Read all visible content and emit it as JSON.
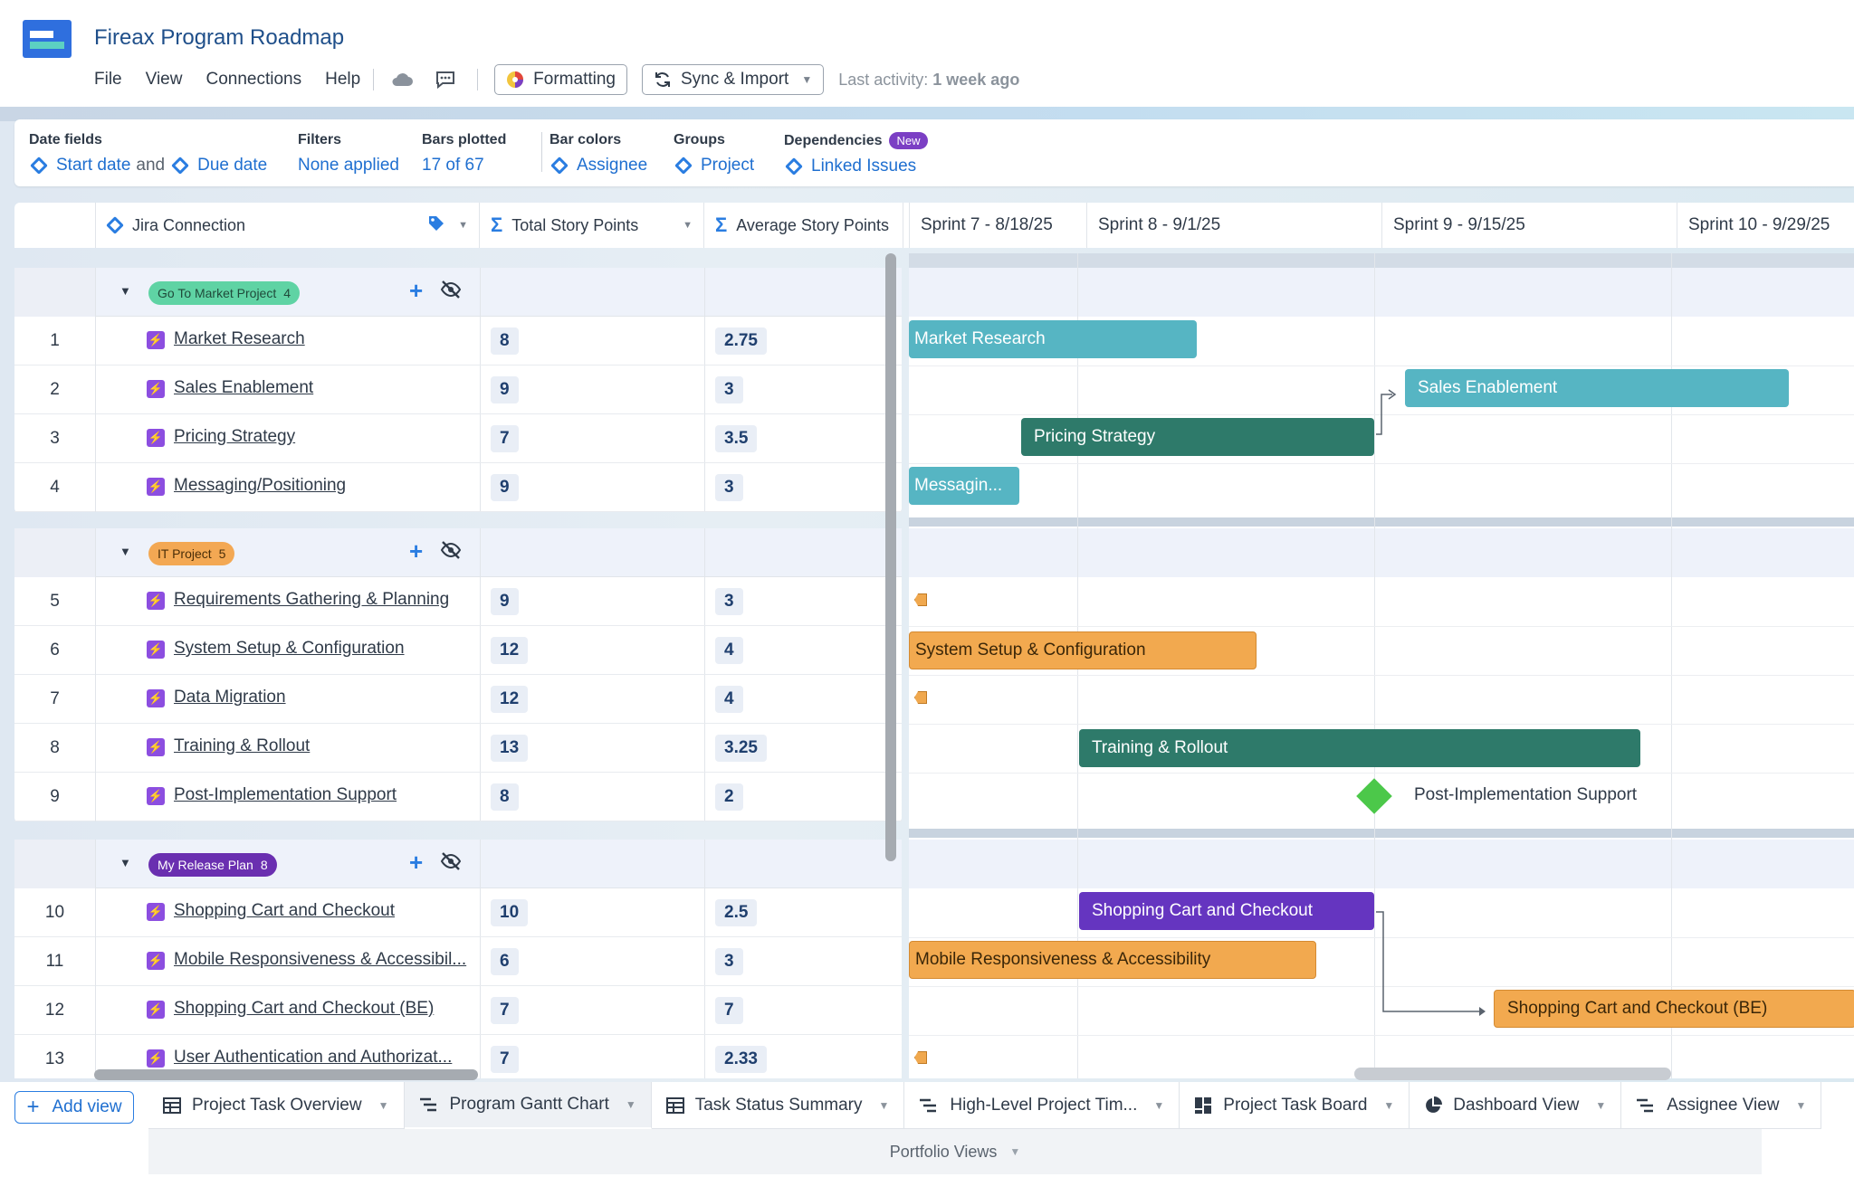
{
  "app": {
    "title": "Fireax Program Roadmap"
  },
  "menu": {
    "file": "File",
    "view": "View",
    "connections": "Connections",
    "help": "Help",
    "formatting": "Formatting",
    "sync": "Sync & Import",
    "last_activity_label": "Last activity:",
    "last_activity_value": "1 week ago"
  },
  "settings": {
    "date_fields": {
      "label": "Date fields",
      "start": "Start date",
      "and": "and",
      "due": "Due date"
    },
    "filters": {
      "label": "Filters",
      "value": "None applied"
    },
    "bars": {
      "label": "Bars plotted",
      "value": "17 of 67"
    },
    "colors": {
      "label": "Bar colors",
      "value": "Assignee"
    },
    "groups": {
      "label": "Groups",
      "value": "Project"
    },
    "deps": {
      "label": "Dependencies",
      "badge": "New",
      "value": "Linked Issues"
    }
  },
  "columns": {
    "name": "Jira Connection",
    "total": "Total Story Points",
    "avg": "Average Story Points"
  },
  "sprints": [
    "Sprint 7 - 8/18/25",
    "Sprint 8 - 9/1/25",
    "Sprint 9 - 9/15/25",
    "Sprint 10 - 9/29/25"
  ],
  "groups": [
    {
      "name": "Go To Market Project",
      "count": "4",
      "color": "#5fd3a4",
      "text": "#1f4a3a"
    },
    {
      "name": "IT Project",
      "count": "5",
      "color": "#f3a853",
      "text": "#4a2e08"
    },
    {
      "name": "My Release Plan",
      "count": "8",
      "color": "#6a2fb0",
      "text": "#ffffff"
    }
  ],
  "rows": [
    {
      "num": "1",
      "name": "Market Research",
      "total": "8",
      "avg": "2.75"
    },
    {
      "num": "2",
      "name": "Sales Enablement",
      "total": "9",
      "avg": "3"
    },
    {
      "num": "3",
      "name": "Pricing Strategy",
      "total": "7",
      "avg": "3.5"
    },
    {
      "num": "4",
      "name": "Messaging/Positioning",
      "total": "9",
      "avg": "3"
    },
    {
      "num": "5",
      "name": "Requirements Gathering & Planning",
      "total": "9",
      "avg": "3"
    },
    {
      "num": "6",
      "name": "System Setup & Configuration",
      "total": "12",
      "avg": "4"
    },
    {
      "num": "7",
      "name": "Data Migration",
      "total": "12",
      "avg": "4"
    },
    {
      "num": "8",
      "name": "Training & Rollout",
      "total": "13",
      "avg": "3.25"
    },
    {
      "num": "9",
      "name": "Post-Implementation Support",
      "total": "8",
      "avg": "2"
    },
    {
      "num": "10",
      "name": "Shopping Cart and Checkout",
      "total": "10",
      "avg": "2.5"
    },
    {
      "num": "11",
      "name": "Mobile Responsiveness & Accessibil...",
      "total": "6",
      "avg": "3"
    },
    {
      "num": "12",
      "name": "Shopping Cart and Checkout (BE)",
      "total": "7",
      "avg": "7"
    },
    {
      "num": "13",
      "name": "User Authentication and Authorizat...",
      "total": "7",
      "avg": "2.33"
    }
  ],
  "bars": {
    "market": "Market Research",
    "sales": "Sales Enablement",
    "pricing": "Pricing Strategy",
    "messaging": "Messagin...",
    "system": "System Setup & Configuration",
    "training": "Training & Rollout",
    "post": "Post-Implementation Support",
    "cart": "Shopping Cart and Checkout",
    "mobile": "Mobile Responsiveness & Accessibility",
    "cartbe": "Shopping Cart and Checkout (BE)"
  },
  "colors": {
    "teal": "#56b5c3",
    "darkgreen": "#2e7a6a",
    "orange": "#f2a94f",
    "purple": "#6535c0",
    "accent": "#2a7de1"
  },
  "footer": {
    "add_view": "Add view",
    "tabs": [
      "Project Task Overview",
      "Program Gantt Chart",
      "Task Status Summary",
      "High-Level Project Tim...",
      "Project Task Board",
      "Dashboard View",
      "Assignee View"
    ],
    "portfolio": "Portfolio Views"
  }
}
